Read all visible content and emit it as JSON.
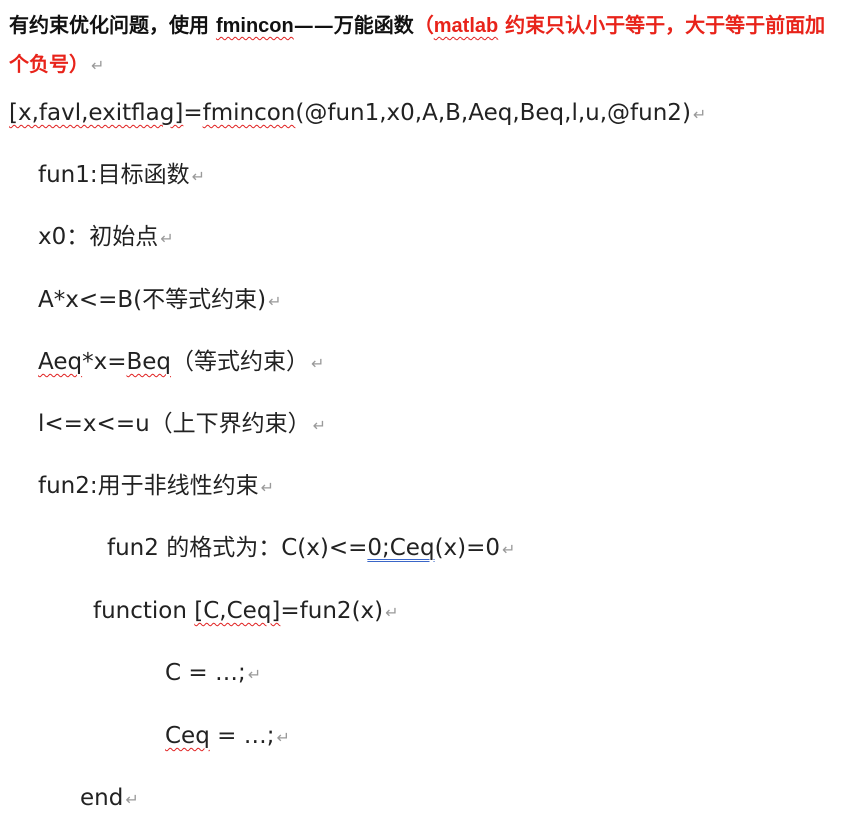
{
  "heading": {
    "part1": "有约束优化问题，使用 ",
    "fn": "fmincon",
    "part2": "——万能函数",
    "note_open": "（",
    "note_matlab": "matlab",
    "note_rest": " 约束只认小于等于，大于等于前面加个负号）",
    "mark": "↵"
  },
  "call": {
    "a": "[x,favl,exitflag]",
    "b": "=",
    "c": "fmincon",
    "d": "(@fun1,x0,A,B,Aeq,Beq,l,u,@fun2)"
  },
  "params": {
    "fun1": "fun1:目标函数",
    "x0": "x0：初始点",
    "ineq": "A*x<=B(不等式约束)",
    "eq_a": "Aeq",
    "eq_b": "*x=",
    "eq_c": "Beq",
    "eq_d": "（等式约束）",
    "bounds": "l<=x<=u（上下界约束）",
    "fun2": "fun2:用于非线性约束"
  },
  "fun2_format": {
    "a": "fun2 的格式为：C(x)<=",
    "b": "0;Ceq",
    "c": "(x)=0"
  },
  "code": {
    "func_a": "function ",
    "func_b": "[C,Ceq]",
    "func_c": "=fun2(x)",
    "c_line": "C = …;",
    "ceq_a": "Ceq",
    "ceq_b": " = …;",
    "end": "end"
  },
  "pilcrow": "↵"
}
